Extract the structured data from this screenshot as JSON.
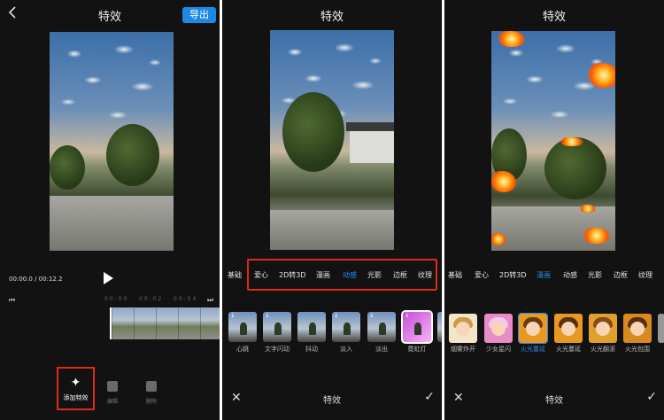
{
  "panel1": {
    "back_icon": "chevron-left-icon",
    "title": "特效",
    "export_label": "导出",
    "time_current": "00:00.0",
    "time_sep": " / ",
    "time_total": "00:12.2",
    "timeline_ticks": "00:00 · 00:02 · 00:04",
    "tools": [
      {
        "label": "添加特效",
        "icon": "sparkle-icon"
      },
      {
        "label": "编辑",
        "icon": "edit-icon"
      },
      {
        "label": "删除",
        "icon": "trash-icon"
      }
    ]
  },
  "panel2": {
    "title": "特效",
    "categories": [
      {
        "label": "基础",
        "active": false
      },
      {
        "label": "爱心",
        "active": false
      },
      {
        "label": "2D转3D",
        "active": false
      },
      {
        "label": "漫画",
        "active": false
      },
      {
        "label": "动感",
        "active": true
      },
      {
        "label": "光影",
        "active": false
      },
      {
        "label": "边框",
        "active": false
      },
      {
        "label": "纹理",
        "active": false
      }
    ],
    "effects": [
      {
        "label": "心跳",
        "active": false
      },
      {
        "label": "文字闪动",
        "active": false
      },
      {
        "label": "抖动",
        "active": false
      },
      {
        "label": "淡入",
        "active": false
      },
      {
        "label": "淡出",
        "active": false
      },
      {
        "label": "霓虹灯",
        "active": false
      }
    ],
    "bottom_title": "特效"
  },
  "panel3": {
    "title": "特效",
    "categories": [
      {
        "label": "基础",
        "active": false
      },
      {
        "label": "爱心",
        "active": false
      },
      {
        "label": "2D转3D",
        "active": false
      },
      {
        "label": "漫画",
        "active": true
      },
      {
        "label": "动感",
        "active": false
      },
      {
        "label": "光影",
        "active": false
      },
      {
        "label": "边框",
        "active": false
      },
      {
        "label": "纹理",
        "active": false
      }
    ],
    "effects": [
      {
        "label": "烟雾炸开",
        "active": false
      },
      {
        "label": "少女星闪",
        "active": false
      },
      {
        "label": "火光蔓延",
        "active": true
      },
      {
        "label": "火光蔓延",
        "active": false
      },
      {
        "label": "火光翻滚",
        "active": false
      },
      {
        "label": "火光包围",
        "active": false
      }
    ],
    "bottom_title": "特效"
  },
  "colors": {
    "accent_blue": "#2a8cf0",
    "export_blue": "#1e88e5",
    "highlight_red": "#e0291e",
    "background": "#121212"
  }
}
